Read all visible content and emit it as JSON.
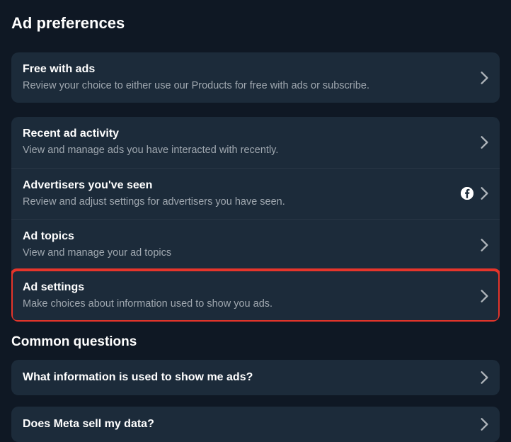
{
  "page_title": "Ad preferences",
  "groups": [
    {
      "items": [
        {
          "title": "Free with ads",
          "subtitle": "Review your choice to either use our Products for free with ads or subscribe."
        }
      ]
    },
    {
      "items": [
        {
          "title": "Recent ad activity",
          "subtitle": "View and manage ads you have interacted with recently."
        },
        {
          "title": "Advertisers you've seen",
          "subtitle": "Review and adjust settings for advertisers you have seen.",
          "facebook_icon": true
        },
        {
          "title": "Ad topics",
          "subtitle": "View and manage your ad topics"
        },
        {
          "title": "Ad settings",
          "subtitle": "Make choices about information used to show you ads.",
          "highlighted": true
        }
      ]
    }
  ],
  "common_questions_title": "Common questions",
  "faq": [
    {
      "title": "What information is used to show me ads?"
    },
    {
      "title": "Does Meta sell my data?"
    }
  ]
}
